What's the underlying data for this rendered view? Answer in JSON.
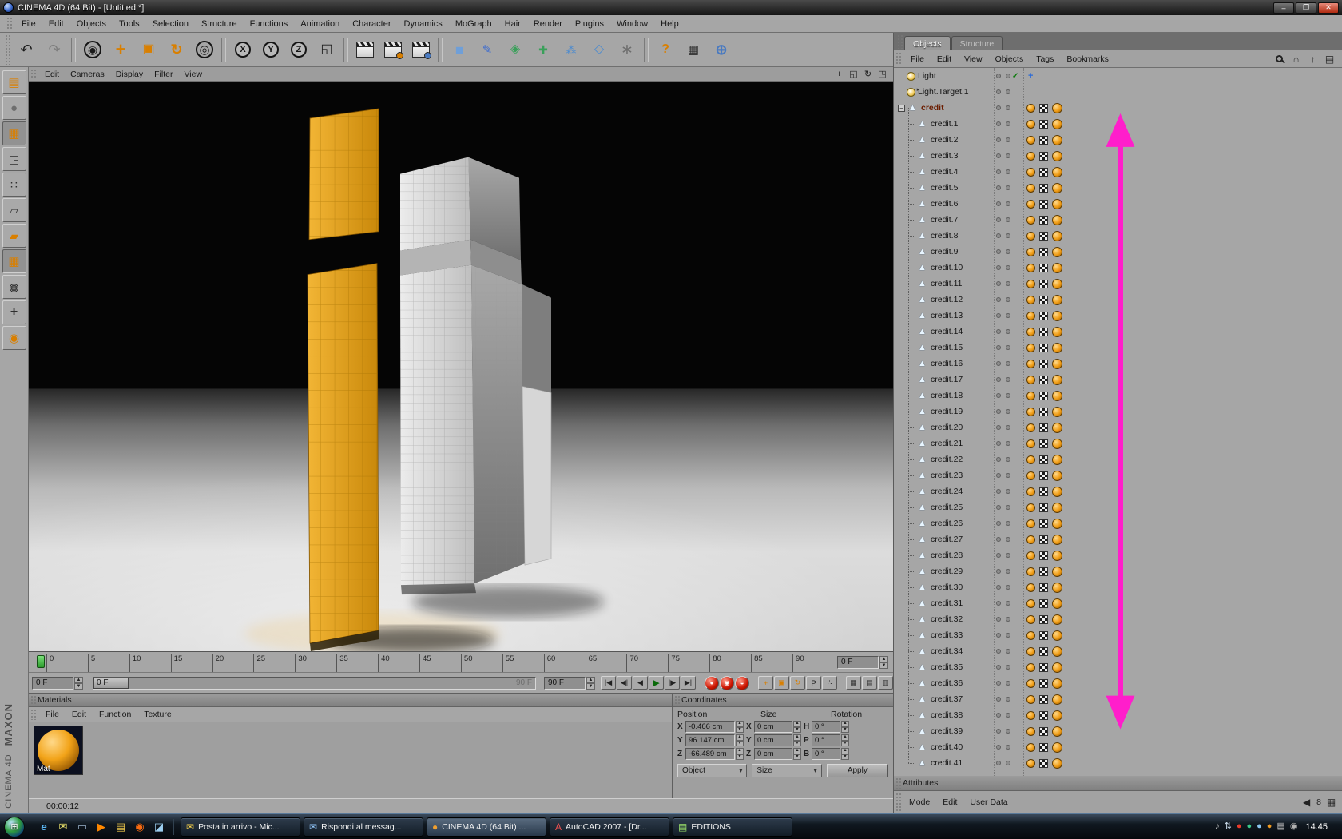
{
  "colors": {
    "accent": "#d97f00",
    "magenta": "#ff1ecb",
    "letter_orange": "#e6a41e",
    "ui_gray": "#a6a6a6"
  },
  "window": {
    "title": "CINEMA 4D (64 Bit) - [Untitled *]",
    "buttons": [
      {
        "name": "minimize-button",
        "glyph": "–"
      },
      {
        "name": "maximize-button",
        "glyph": "❐"
      },
      {
        "name": "close-button",
        "glyph": "✕",
        "close": true
      }
    ]
  },
  "menu_bar": [
    "File",
    "Edit",
    "Objects",
    "Tools",
    "Selection",
    "Structure",
    "Functions",
    "Animation",
    "Character",
    "Dynamics",
    "MoGraph",
    "Hair",
    "Render",
    "Plugins",
    "Window",
    "Help"
  ],
  "toolbar": [
    {
      "name": "undo-button",
      "glyph": "↶",
      "color": "#1a1a1a",
      "size": 18
    },
    {
      "name": "redo-button",
      "glyph": "↷",
      "color": "#7e7e7e",
      "size": 18
    },
    {
      "sep": true
    },
    {
      "name": "live-selection-tool",
      "glyph": "◉",
      "color": "#1a1a1a",
      "size": 14,
      "ring": true
    },
    {
      "name": "move-tool",
      "glyph": "+",
      "color": "#d97f00",
      "size": 22,
      "bold": true
    },
    {
      "name": "scale-tool",
      "glyph": "▣",
      "color": "#d97f00",
      "size": 16
    },
    {
      "name": "rotate-tool",
      "glyph": "↻",
      "color": "#d97f00",
      "size": 18,
      "bold": true
    },
    {
      "name": "last-used-tool",
      "glyph": "◎",
      "color": "#1a1a1a",
      "size": 15,
      "ring": true
    },
    {
      "sep": true
    },
    {
      "name": "lock-x-axis-button",
      "kind": "circ",
      "glyph": "X"
    },
    {
      "name": "lock-y-axis-button",
      "kind": "circ",
      "glyph": "Y"
    },
    {
      "name": "lock-z-axis-button",
      "kind": "circ",
      "glyph": "Z"
    },
    {
      "name": "coordinate-system-toggle",
      "glyph": "◱",
      "color": "#1a1a1a",
      "size": 16
    },
    {
      "sep": true
    },
    {
      "name": "render-view-button",
      "kind": "clap"
    },
    {
      "name": "render-picture-viewer-button",
      "kind": "clap",
      "badge": "#d97f00"
    },
    {
      "name": "render-settings-button",
      "kind": "clap",
      "badge": "#4a7ac0"
    },
    {
      "sep": true
    },
    {
      "name": "add-cube-object-button",
      "glyph": "■",
      "color": "#6f9fd8",
      "size": 17
    },
    {
      "name": "add-spline-object-button",
      "glyph": "✎",
      "color": "#3a6ad0",
      "size": 15
    },
    {
      "name": "add-nurbs-object-button",
      "glyph": "◈",
      "color": "#3aa05a",
      "size": 16
    },
    {
      "name": "add-modeling-object-button",
      "glyph": "✚",
      "color": "#3aa05a",
      "size": 14
    },
    {
      "name": "add-array-object-button",
      "glyph": "⁂",
      "color": "#4a8ad0",
      "size": 13
    },
    {
      "name": "add-deformer-object-button",
      "glyph": "◇",
      "color": "#4a8ad0",
      "size": 16
    },
    {
      "name": "add-particles-object-button",
      "glyph": "∗",
      "color": "#6e6e6e",
      "size": 19
    },
    {
      "sep": true
    },
    {
      "name": "help-button",
      "glyph": "?",
      "color": "#d97f00",
      "size": 16,
      "bold": true
    },
    {
      "name": "snap-settings-button",
      "glyph": "▦",
      "color": "#2e2e2e",
      "size": 15
    },
    {
      "name": "online-resources-button",
      "glyph": "⊕",
      "color": "#4a7ac0",
      "size": 18,
      "bold": true
    }
  ],
  "palette": [
    {
      "name": "make-editable-tool",
      "glyph": "▤",
      "color": "#d97f00",
      "size": 15
    },
    {
      "name": "model-mode-tool",
      "glyph": "●",
      "color": "#6e6e6e",
      "size": 15
    },
    {
      "name": "texture-mode-tool",
      "glyph": "▦",
      "color": "#d97f00",
      "size": 15,
      "pressed": true
    },
    {
      "name": "workplane-mode-tool",
      "glyph": "◳",
      "color": "#2e2e2e",
      "size": 14
    },
    {
      "name": "points-mode-tool",
      "glyph": "∷",
      "color": "#2e2e2e",
      "size": 14
    },
    {
      "name": "edges-mode-tool",
      "glyph": "▱",
      "color": "#2e2e2e",
      "size": 14
    },
    {
      "name": "polygons-mode-tool",
      "glyph": "▰",
      "color": "#d97f00",
      "size": 14
    },
    {
      "name": "uv-mode-tool",
      "glyph": "▦",
      "color": "#d97f00",
      "size": 15,
      "pressed": true
    },
    {
      "name": "texture-axis-mode-tool",
      "glyph": "▩",
      "color": "#2e2e2e",
      "size": 14
    },
    {
      "name": "object-axis-mode-tool",
      "glyph": "+",
      "color": "#2e2e2e",
      "size": 16,
      "bold": true
    },
    {
      "name": "render-seeds-tool",
      "glyph": "◉",
      "color": "#d97f00",
      "size": 15
    }
  ],
  "brand": {
    "maxon": "MAXON",
    "cinema": "CINEMA 4D"
  },
  "viewport": {
    "menu": [
      "Edit",
      "Cameras",
      "Display",
      "Filter",
      "View"
    ],
    "icons": [
      {
        "name": "pan-view-icon",
        "glyph": "+"
      },
      {
        "name": "zoom-view-icon",
        "glyph": "◱"
      },
      {
        "name": "rotate-view-icon",
        "glyph": "↻"
      },
      {
        "name": "toggle-view-icon",
        "glyph": "◳"
      }
    ]
  },
  "timeline": {
    "ticks": [
      "0",
      "5",
      "10",
      "15",
      "20",
      "25",
      "30",
      "35",
      "40",
      "45",
      "50",
      "55",
      "60",
      "65",
      "70",
      "75",
      "80",
      "85",
      "90"
    ],
    "frame_field": "0 F",
    "start_field": "0 F",
    "end_field": "90 F",
    "slider_handle": "0 F",
    "slider_end": "90 F",
    "transport": [
      {
        "name": "goto-start-button",
        "glyph": "|◀"
      },
      {
        "name": "previous-key-button",
        "glyph": "◀|"
      },
      {
        "name": "previous-frame-button",
        "glyph": "◀"
      },
      {
        "name": "play-button",
        "glyph": "▶",
        "green": true
      },
      {
        "name": "next-frame-button",
        "glyph": "|▶"
      },
      {
        "name": "goto-end-button",
        "glyph": "▶|"
      }
    ],
    "record": [
      {
        "name": "record-keyframe-button",
        "glyph": "●"
      },
      {
        "name": "autokey-button",
        "glyph": "◉"
      },
      {
        "name": "record-settings-button",
        "glyph": "◒"
      }
    ],
    "keys": [
      {
        "name": "key-position-button",
        "glyph": "+",
        "color": "#d97f00"
      },
      {
        "name": "key-scale-button",
        "glyph": "▣",
        "color": "#d97f00"
      },
      {
        "name": "key-rotation-button",
        "glyph": "↻",
        "color": "#d97f00"
      },
      {
        "name": "key-parameter-button",
        "glyph": "P",
        "color": "#1a1a1a"
      },
      {
        "name": "key-pla-button",
        "glyph": "∴",
        "color": "#1a1a1a"
      }
    ],
    "extras": [
      {
        "name": "keyframe-selection-button",
        "glyph": "▦",
        "color": "#2e2e2e"
      },
      {
        "name": "timeline-layout-button",
        "glyph": "▤",
        "color": "#2e2e2e"
      },
      {
        "name": "powerslider-options-button",
        "glyph": "▥",
        "color": "#2e2e2e"
      }
    ]
  },
  "materials": {
    "title": "Materials",
    "menu": [
      "File",
      "Edit",
      "Function",
      "Texture"
    ],
    "items": [
      {
        "label": "Mat"
      }
    ]
  },
  "coordinates": {
    "title": "Coordinates",
    "columns": [
      "Position",
      "Size",
      "Rotation"
    ],
    "rows": [
      {
        "pos_label": "X",
        "pos": "-0.466 cm",
        "size_label": "X",
        "size": "0 cm",
        "rot_label": "H",
        "rot": "0 °"
      },
      {
        "pos_label": "Y",
        "pos": "96.147 cm",
        "size_label": "Y",
        "size": "0 cm",
        "rot_label": "P",
        "rot": "0 °"
      },
      {
        "pos_label": "Z",
        "pos": "-66.489 cm",
        "size_label": "Z",
        "size": "0 cm",
        "rot_label": "B",
        "rot": "0 °"
      }
    ],
    "object_mode": "Object",
    "size_mode": "Size",
    "apply_label": "Apply"
  },
  "status": "00:00:12",
  "objects_panel": {
    "tabs": [
      {
        "label": "Objects",
        "active": true
      },
      {
        "label": "Structure"
      }
    ],
    "menu": [
      "File",
      "Edit",
      "View",
      "Objects",
      "Tags",
      "Bookmarks"
    ],
    "icons": [
      {
        "name": "search-icon",
        "css": "search"
      },
      {
        "name": "home-icon",
        "glyph": "⌂"
      },
      {
        "name": "parent-up-icon",
        "glyph": "↑"
      },
      {
        "name": "panel-menu-icon",
        "glyph": "▤"
      }
    ],
    "items": [
      {
        "label": "Light",
        "icon": "light",
        "child": false,
        "tags": false,
        "check": true
      },
      {
        "label": "Light.Target.1",
        "icon": "light-target",
        "child": false,
        "tags": false
      },
      {
        "label": "credit",
        "child": false,
        "expander": true,
        "selected": true
      },
      {
        "label": "credit.1"
      },
      {
        "label": "credit.2"
      },
      {
        "label": "credit.3"
      },
      {
        "label": "credit.4"
      },
      {
        "label": "credit.5"
      },
      {
        "label": "credit.6"
      },
      {
        "label": "credit.7"
      },
      {
        "label": "credit.8"
      },
      {
        "label": "credit.9"
      },
      {
        "label": "credit.10"
      },
      {
        "label": "credit.11"
      },
      {
        "label": "credit.12"
      },
      {
        "label": "credit.13"
      },
      {
        "label": "credit.14"
      },
      {
        "label": "credit.15"
      },
      {
        "label": "credit.16"
      },
      {
        "label": "credit.17"
      },
      {
        "label": "credit.18"
      },
      {
        "label": "credit.19"
      },
      {
        "label": "credit.20"
      },
      {
        "label": "credit.21"
      },
      {
        "label": "credit.22"
      },
      {
        "label": "credit.23"
      },
      {
        "label": "credit.24"
      },
      {
        "label": "credit.25"
      },
      {
        "label": "credit.26"
      },
      {
        "label": "credit.27"
      },
      {
        "label": "credit.28"
      },
      {
        "label": "credit.29"
      },
      {
        "label": "credit.30"
      },
      {
        "label": "credit.31"
      },
      {
        "label": "credit.32"
      },
      {
        "label": "credit.33"
      },
      {
        "label": "credit.34"
      },
      {
        "label": "credit.35"
      },
      {
        "label": "credit.36"
      },
      {
        "label": "credit.37"
      },
      {
        "label": "credit.38"
      },
      {
        "label": "credit.39"
      },
      {
        "label": "credit.40"
      },
      {
        "label": "credit.41"
      }
    ]
  },
  "attributes": {
    "title": "Attributes",
    "menu": [
      "Mode",
      "Edit",
      "User Data"
    ],
    "right_label": "8",
    "icons": [
      {
        "name": "prev-panel-icon",
        "glyph": "◀"
      },
      {
        "name": "layout-grid-icon",
        "glyph": "▦"
      }
    ]
  },
  "taskbar": {
    "quicklaunch": [
      {
        "name": "internet-explorer-icon",
        "glyph": "e",
        "color": "#5ab4f0",
        "bold": true,
        "italic": true
      },
      {
        "name": "mail-icon",
        "glyph": "✉",
        "color": "#e8e06a"
      },
      {
        "name": "show-desktop-icon",
        "glyph": "▭",
        "color": "#9ab4cc"
      },
      {
        "name": "media-player-icon",
        "glyph": "▶",
        "color": "#ff8800"
      },
      {
        "name": "folder-icon",
        "glyph": "▤",
        "color": "#e8c34a"
      },
      {
        "name": "firefox-icon",
        "glyph": "◉",
        "color": "#f86a10"
      },
      {
        "name": "photo-viewer-icon",
        "glyph": "◪",
        "color": "#9ccff0"
      }
    ],
    "buttons": [
      {
        "label": "Posta in arrivo - Mic...",
        "icon_glyph": "✉",
        "icon_color": "#f7d24a"
      },
      {
        "label": "Rispondi al messag...",
        "icon_glyph": "✉",
        "icon_color": "#8fc3f7"
      },
      {
        "label": "CINEMA 4D (64 Bit) ...",
        "icon_glyph": "●",
        "icon_color": "#f0a030",
        "active": true
      },
      {
        "label": "AutoCAD 2007 - [Dr...",
        "icon_glyph": "A",
        "icon_color": "#e85050"
      },
      {
        "label": "EDITIONS",
        "icon_glyph": "▤",
        "icon_color": "#9ae06a"
      }
    ],
    "tray": [
      {
        "name": "tray-volume-icon",
        "glyph": "♪",
        "color": "#e8e8e8"
      },
      {
        "name": "tray-network-icon",
        "glyph": "⇅",
        "color": "#cfe0f0"
      },
      {
        "name": "tray-antivirus-icon",
        "glyph": "●",
        "color": "#e83a2a"
      },
      {
        "name": "tray-messenger-icon",
        "glyph": "●",
        "color": "#3ac88a"
      },
      {
        "name": "tray-update-icon",
        "glyph": "●",
        "color": "#8ac4f0"
      },
      {
        "name": "tray-graphics-icon",
        "glyph": "●",
        "color": "#f09a20"
      },
      {
        "name": "tray-printer-icon",
        "glyph": "▤",
        "color": "#cccccc"
      },
      {
        "name": "tray-cd-icon",
        "glyph": "◉",
        "color": "#b0b0b0"
      }
    ],
    "clock": "14.45"
  }
}
